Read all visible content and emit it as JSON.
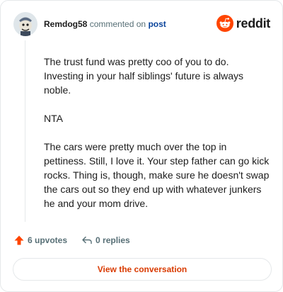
{
  "header": {
    "username": "Remdog58",
    "action_text": "commented on",
    "post_link": "post",
    "logo_text": "reddit"
  },
  "comment": {
    "paragraphs": [
      "The trust fund was pretty coo of you to do. Investing in your half siblings' future is always noble.",
      "NTA",
      "The cars were pretty much over the top in pettiness. Still, I love it. Your step father can go kick rocks. Thing is, though, make sure he doesn't swap the cars out so they end up with whatever junkers he and your mom drive."
    ]
  },
  "actions": {
    "upvotes_label": "6 upvotes",
    "replies_label": "0 replies"
  },
  "footer": {
    "view_button_label": "View the conversation"
  },
  "icons": {
    "avatar": "avatar-icon",
    "reddit_logo": "reddit-logo-icon",
    "upvote": "upvote-arrow-icon",
    "reply": "reply-arrow-icon"
  },
  "colors": {
    "brand_orange": "#ff4500",
    "link_blue": "#0a449b",
    "button_text": "#d93a00",
    "muted_text": "#576f76"
  }
}
